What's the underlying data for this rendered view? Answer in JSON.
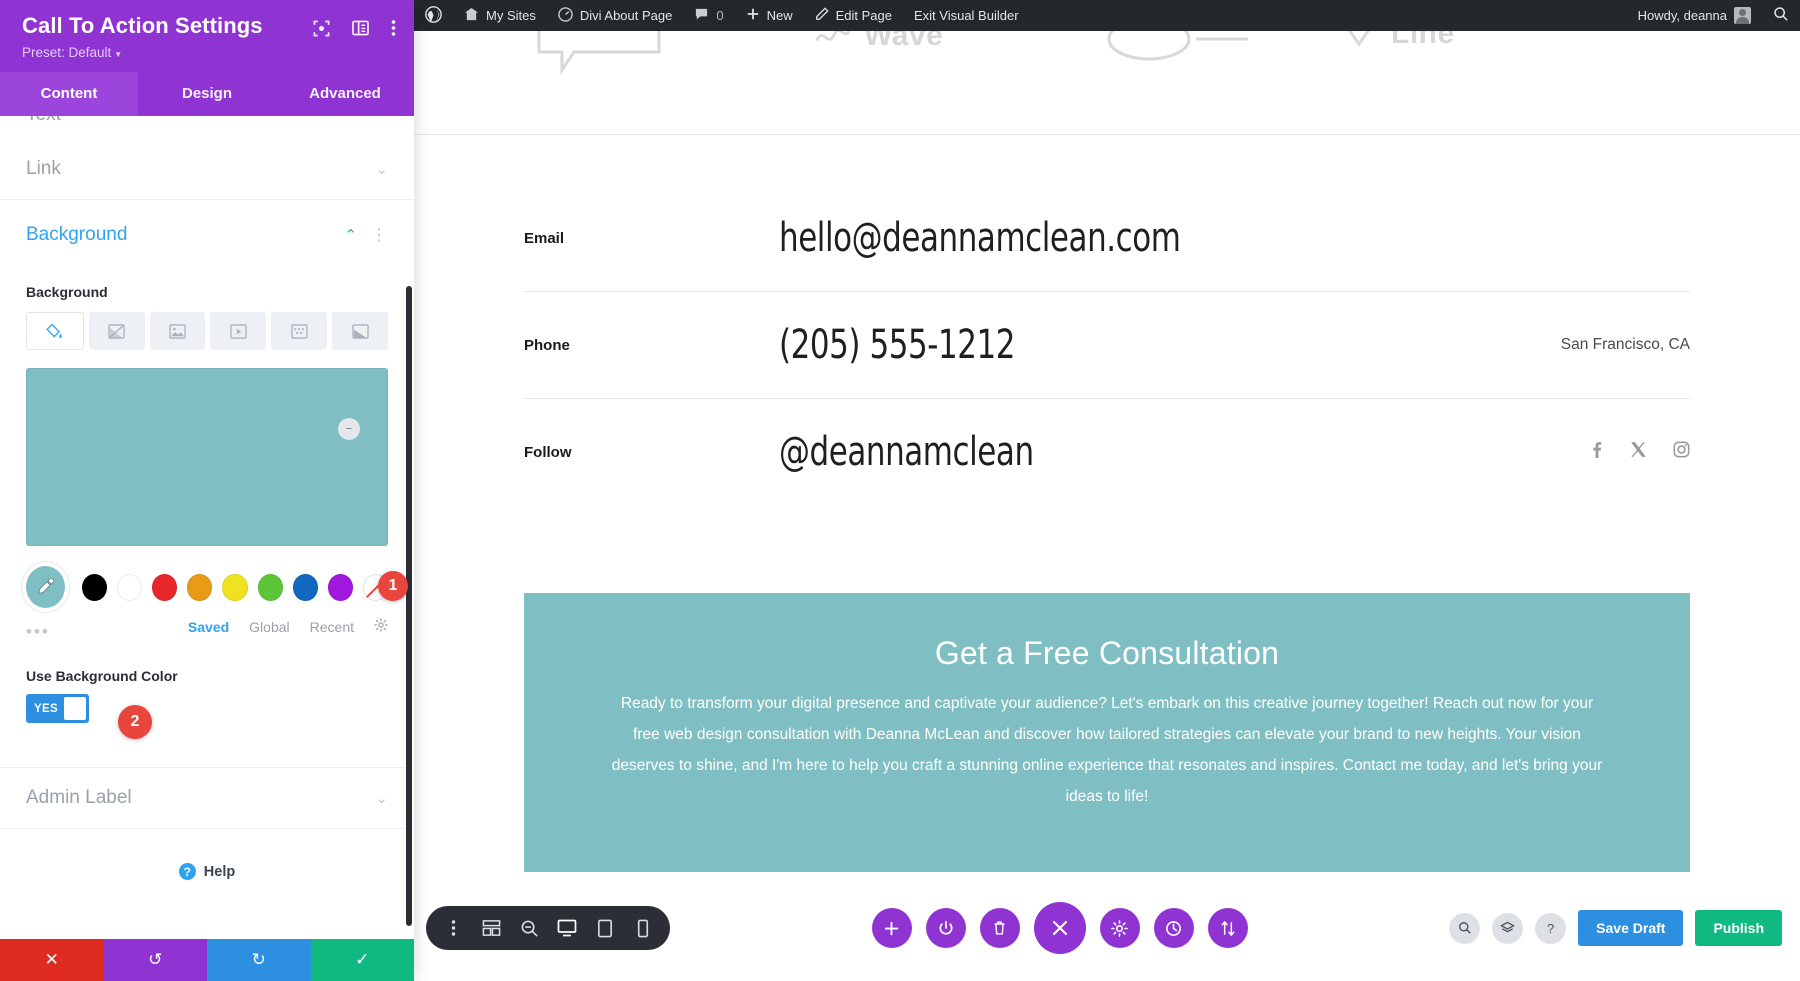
{
  "sidebar": {
    "title": "Call To Action Settings",
    "preset": "Preset: Default",
    "head_icons": [
      {
        "name": "focus-icon"
      },
      {
        "name": "layout-columns-icon"
      },
      {
        "name": "kebab-menu-icon"
      }
    ],
    "tabs": [
      {
        "label": "Content",
        "active": true
      },
      {
        "label": "Design",
        "active": false
      },
      {
        "label": "Advanced",
        "active": false
      }
    ],
    "sections": [
      {
        "label": "Text",
        "state": "collapsed"
      },
      {
        "label": "Link",
        "state": "collapsed"
      },
      {
        "label": "Background",
        "state": "open"
      },
      {
        "label": "Admin Label",
        "state": "collapsed"
      }
    ],
    "background": {
      "field_label": "Background",
      "types": [
        {
          "name": "background-color-icon",
          "active": true
        },
        {
          "name": "background-gradient-icon",
          "active": false
        },
        {
          "name": "background-image-icon",
          "active": false
        },
        {
          "name": "background-video-icon",
          "active": false
        },
        {
          "name": "background-pattern-icon",
          "active": false
        },
        {
          "name": "background-mask-icon",
          "active": false
        }
      ],
      "selected_color": "#7FBFC4",
      "swatches": [
        {
          "name": "eyedropper",
          "color": "#7FBFC4"
        },
        {
          "name": "black",
          "color": "#000000"
        },
        {
          "name": "white",
          "color": "#FFFFFF"
        },
        {
          "name": "red",
          "color": "#E8272B"
        },
        {
          "name": "orange",
          "color": "#E79B17"
        },
        {
          "name": "yellow",
          "color": "#EFE321"
        },
        {
          "name": "green",
          "color": "#5DC638"
        },
        {
          "name": "blue",
          "color": "#1268BE"
        },
        {
          "name": "purple",
          "color": "#A018DE"
        },
        {
          "name": "none",
          "color": "transparent"
        }
      ],
      "palette_tabs": [
        {
          "label": "Saved",
          "active": true
        },
        {
          "label": "Global",
          "active": false
        },
        {
          "label": "Recent",
          "active": false
        }
      ],
      "more_dots": "•••",
      "gear_icon": "gear-icon"
    },
    "use_background_color": {
      "label": "Use Background Color",
      "value": "YES"
    },
    "help": {
      "label": "Help",
      "icon": "question-mark-icon"
    },
    "footer": [
      {
        "name": "discard-button",
        "glyph": "✕"
      },
      {
        "name": "undo-button",
        "glyph": "↺"
      },
      {
        "name": "redo-button",
        "glyph": "↻"
      },
      {
        "name": "save-button",
        "glyph": "✓"
      }
    ],
    "badges": [
      {
        "number": "1"
      },
      {
        "number": "2"
      }
    ]
  },
  "adminbar": {
    "items": [
      {
        "label": "",
        "icon": "wordpress-logo-icon"
      },
      {
        "label": "My Sites",
        "icon": "sites-icon"
      },
      {
        "label": "Divi About Page",
        "icon": "dashboard-icon"
      },
      {
        "label": "0",
        "icon": "comment-bubble-icon"
      },
      {
        "label": "New",
        "icon": "plus-icon"
      },
      {
        "label": "Edit Page",
        "icon": "pencil-icon"
      },
      {
        "label": "Exit Visual Builder",
        "icon": ""
      }
    ],
    "howdy": "Howdy, deanna",
    "search_icon": "search-icon"
  },
  "canvas": {
    "feature_strip": [
      {
        "label": "Wave",
        "icon": "wave-icon"
      },
      {
        "label": "Line",
        "icon": "line-icon"
      }
    ],
    "contact_rows": [
      {
        "label": "Email",
        "value": "hello@deannamclean.com",
        "extra": ""
      },
      {
        "label": "Phone",
        "value": "(205) 555-1212",
        "extra": "San Francisco, CA"
      },
      {
        "label": "Follow",
        "value": "@deannamclean",
        "extra": "",
        "socials": [
          "facebook-icon",
          "x-twitter-icon",
          "instagram-icon"
        ]
      }
    ],
    "cta": {
      "background": "#7FBFC4",
      "heading": "Get a Free Consultation",
      "body": "Ready to transform your digital presence and captivate your audience? Let's embark on this creative journey together! Reach out now for your free web design consultation with Deanna McLean and discover how tailored strategies can elevate your brand to new heights. Your vision deserves to shine, and I'm here to help you craft a stunning online experience that resonates and inspires. Contact me today, and let's bring your ideas to life!"
    }
  },
  "builder_bar": {
    "left_tools": [
      {
        "name": "kebab-menu-icon",
        "active": false
      },
      {
        "name": "wireframe-view-icon",
        "active": false
      },
      {
        "name": "zoom-out-view-icon",
        "active": false
      },
      {
        "name": "desktop-view-icon",
        "active": true
      },
      {
        "name": "tablet-view-icon",
        "active": false
      },
      {
        "name": "phone-view-icon",
        "active": false
      }
    ],
    "center_tools": [
      {
        "name": "add-module-button",
        "glyph": "+"
      },
      {
        "name": "power-toggle-button",
        "glyph": "⏻"
      },
      {
        "name": "trash-button",
        "glyph": "Ὕ1"
      },
      {
        "name": "close-builder-button",
        "glyph": "✕"
      },
      {
        "name": "settings-button",
        "glyph": "⚙"
      },
      {
        "name": "history-button",
        "glyph": "◴"
      },
      {
        "name": "portability-button",
        "glyph": "⇅"
      }
    ],
    "right_tools": [
      {
        "name": "search-button",
        "glyph": "⌕"
      },
      {
        "name": "layers-button",
        "glyph": "☰"
      },
      {
        "name": "help-button",
        "glyph": "?"
      }
    ],
    "save_draft_label": "Save Draft",
    "publish_label": "Publish"
  },
  "colors": {
    "purple": "#8F34D2",
    "teal": "#7FBFC4",
    "blue": "#2C8FE0",
    "green": "#10B981",
    "red": "#E8453C",
    "dark": "#23282D"
  }
}
